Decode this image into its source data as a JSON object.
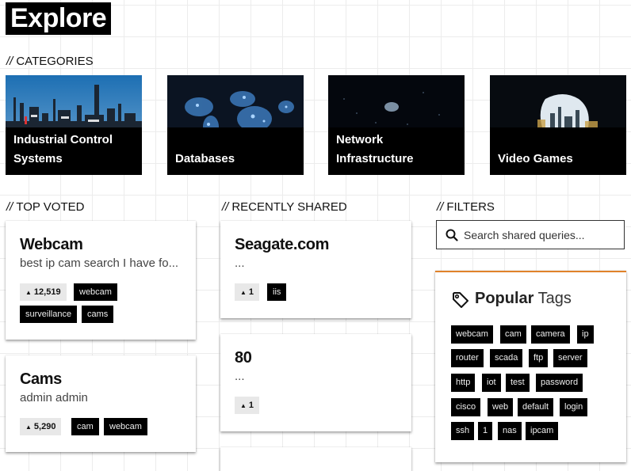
{
  "page": {
    "title": "Explore"
  },
  "sections": {
    "categories": "CATEGORIES",
    "top_voted": "TOP VOTED",
    "recently_shared": "RECENTLY SHARED",
    "filters": "FILTERS",
    "prefix": "//"
  },
  "categories": [
    {
      "label": "Industrial Control Systems",
      "icon": "industrial-plant-image"
    },
    {
      "label": "Databases",
      "icon": "database-map-image"
    },
    {
      "label": "Network Infrastructure",
      "icon": "network-map-image"
    },
    {
      "label": "Video Games",
      "icon": "video-game-image"
    }
  ],
  "top_voted": [
    {
      "title": "Webcam",
      "description": "best ip cam search I have fo...",
      "votes": "12,519",
      "tags": [
        "webcam",
        "surveillance",
        "cams"
      ]
    },
    {
      "title": "Cams",
      "description": "admin admin",
      "votes": "5,290",
      "tags": [
        "cam",
        "webcam"
      ]
    }
  ],
  "recently_shared": [
    {
      "title": "Seagate.com",
      "description": "...",
      "votes": "1",
      "tags": [
        "iis"
      ]
    },
    {
      "title": "80",
      "description": "...",
      "votes": "1",
      "tags": []
    }
  ],
  "filters": {
    "search_placeholder": "Search shared queries...",
    "search_value": ""
  },
  "popular_tags": {
    "heading_bold": "Popular",
    "heading_light": "Tags",
    "tags": [
      "webcam",
      "cam",
      "camera",
      "ip",
      "router",
      "scada",
      "ftp",
      "server",
      "http",
      "iot",
      "test",
      "password",
      "cisco",
      "web",
      "default",
      "login",
      "ssh",
      "1",
      "nas",
      "ipcam"
    ]
  },
  "colors": {
    "accent": "#e0822a",
    "chip_bg": "#000000",
    "vote_bg": "#e8e8e8"
  }
}
